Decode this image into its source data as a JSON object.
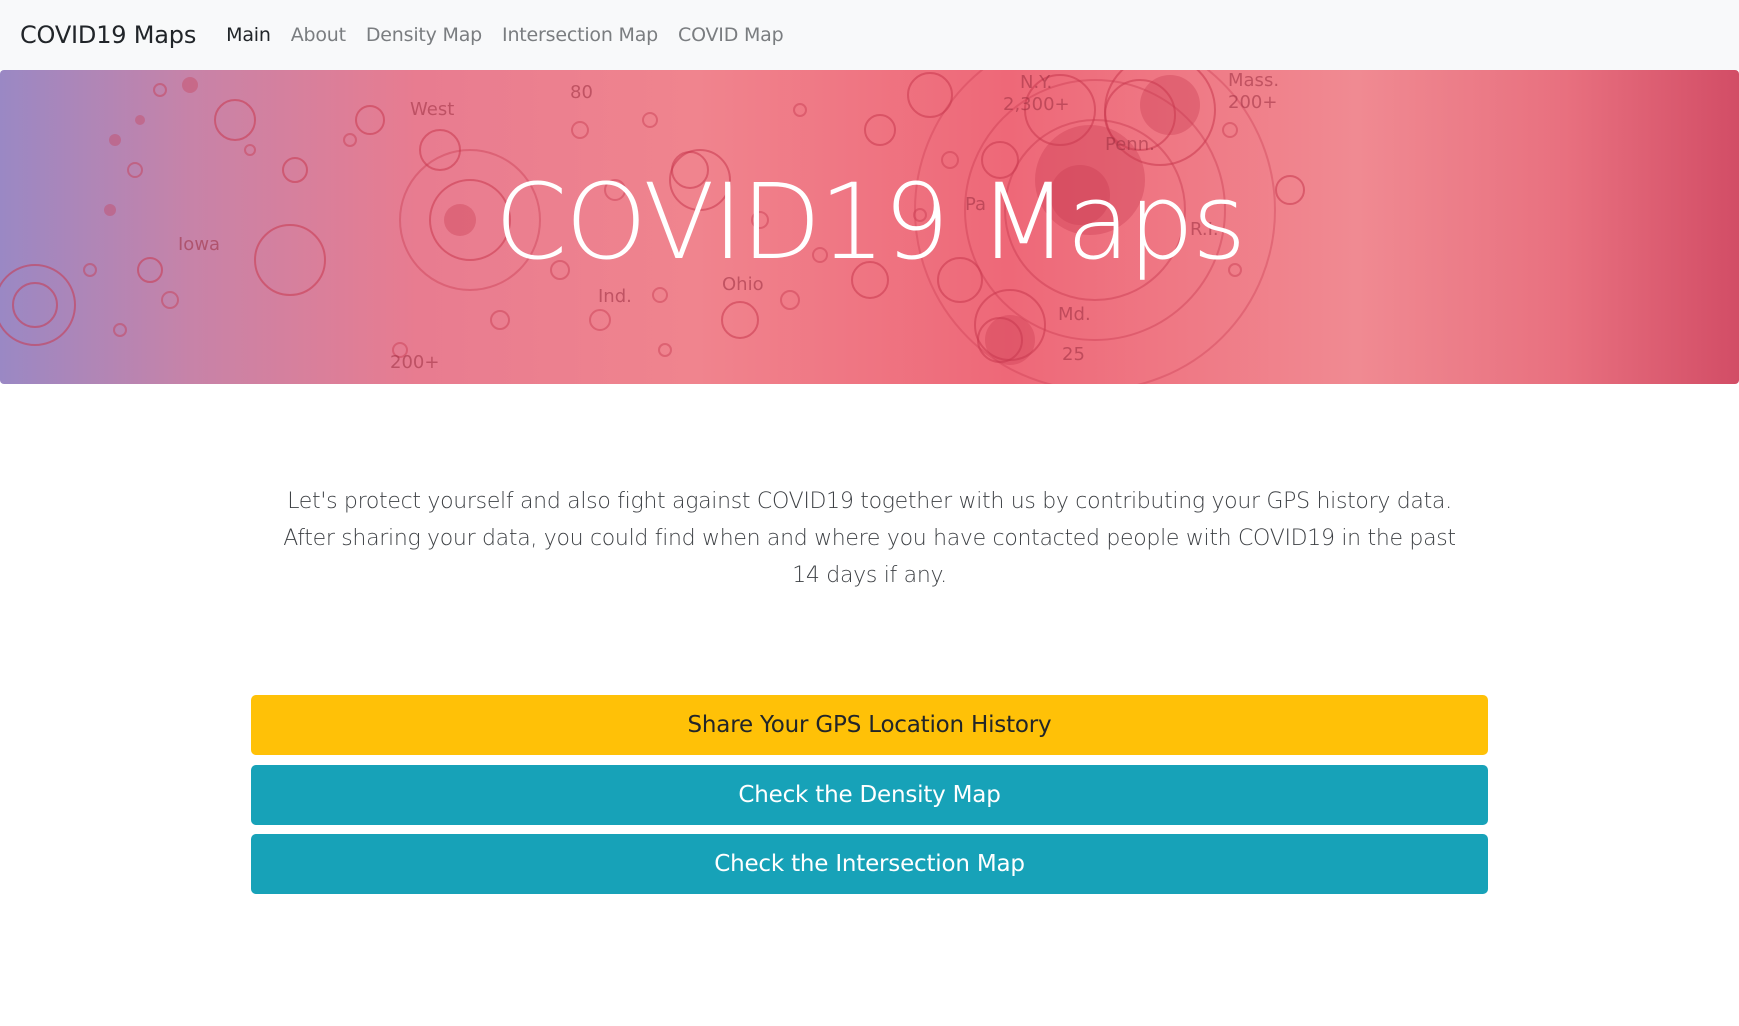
{
  "navbar": {
    "brand": "COVID19 Maps",
    "links": [
      {
        "label": "Main",
        "active": true
      },
      {
        "label": "About",
        "active": false
      },
      {
        "label": "Density Map",
        "active": false
      },
      {
        "label": "Intersection Map",
        "active": false
      },
      {
        "label": "COVID Map",
        "active": false
      }
    ]
  },
  "hero": {
    "title": "COVID19 Maps",
    "map_labels": [
      "80",
      "N.Y.",
      "2,300+",
      "Mass.",
      "200+",
      "West",
      "Penn.",
      "Pa",
      "Iowa",
      "Ind.",
      "Ohio",
      "R.I.",
      "Md.",
      "200+",
      "25"
    ]
  },
  "intro": {
    "line1": "Let's protect yourself and also fight against COVID19 together with us by contributing your GPS history data.",
    "line2": "After sharing your data, you could find when and where you have contacted people with COVID19 in the past 14 days if any."
  },
  "buttons": {
    "share": "Share Your GPS Location History",
    "density": "Check the Density Map",
    "intersection": "Check the Intersection Map"
  },
  "colors": {
    "navbar_bg": "#f8f9fa",
    "warning": "#ffc107",
    "info": "#17a2b8"
  }
}
